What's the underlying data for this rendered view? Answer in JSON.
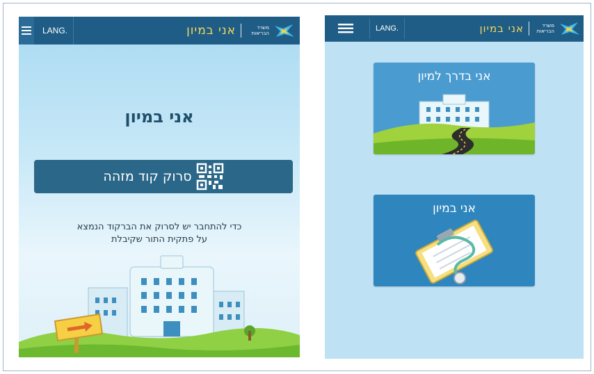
{
  "left_screen": {
    "header": {
      "lang_label": "LANG.",
      "app_title": "אני במיון",
      "brand_line1": "משרד",
      "brand_line2": "הבריאות"
    },
    "title": "אני במיון",
    "scan_button_label": "סרוק קוד מזהה",
    "instructions_line1": "כדי להתחבר יש לסרוק את הברקוד הנמצא",
    "instructions_line2": "על פתקית התור שקיבלת"
  },
  "right_screen": {
    "header": {
      "lang_label": "LANG.",
      "app_title": "אני במיון",
      "brand_line1": "משרד",
      "brand_line2": "הבריאות"
    },
    "cards": [
      {
        "label": "אני בדרך למיון",
        "icon": "hospital-road-icon"
      },
      {
        "label": "אני במיון",
        "icon": "clipboard-stethoscope-icon"
      }
    ]
  },
  "colors": {
    "header_bg": "#1f5d86",
    "title_accent": "#f6d85b",
    "button_bg": "#2a6788",
    "card_bg": "#3a8cbf",
    "screen_bg": "#bfe1f4"
  }
}
